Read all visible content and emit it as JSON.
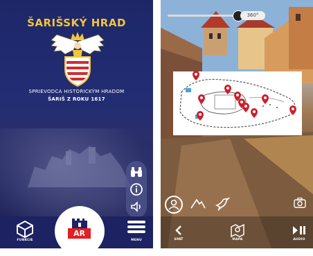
{
  "left_screen": {
    "title": "ŠARIŠSKÝ HRAD",
    "subtitle_line1": "SPRIEVODCA HISTORICKÝM HRADOM",
    "subtitle_line2": "ŠARIŠ Z ROKU 1617",
    "ar_label": "AR",
    "bottom_left_label": "FUNKCIE",
    "bottom_right_label": "MENU",
    "side_icons": [
      "binoculars-icon",
      "info-icon",
      "speaker-icon"
    ],
    "colors": {
      "background": "#1d2768",
      "title": "#f2c53d",
      "ar_red": "#e31e24"
    }
  },
  "right_screen": {
    "degree_label": "360°",
    "bottom_left_label": "SPÄŤ",
    "bottom_center_label": "MAPA",
    "bottom_right_label": "AUDIO",
    "map_pin_color": "#cc1f2b",
    "hud_icons": [
      "person-icon",
      "mountain-icon",
      "bird-icon",
      "camera-icon"
    ]
  }
}
